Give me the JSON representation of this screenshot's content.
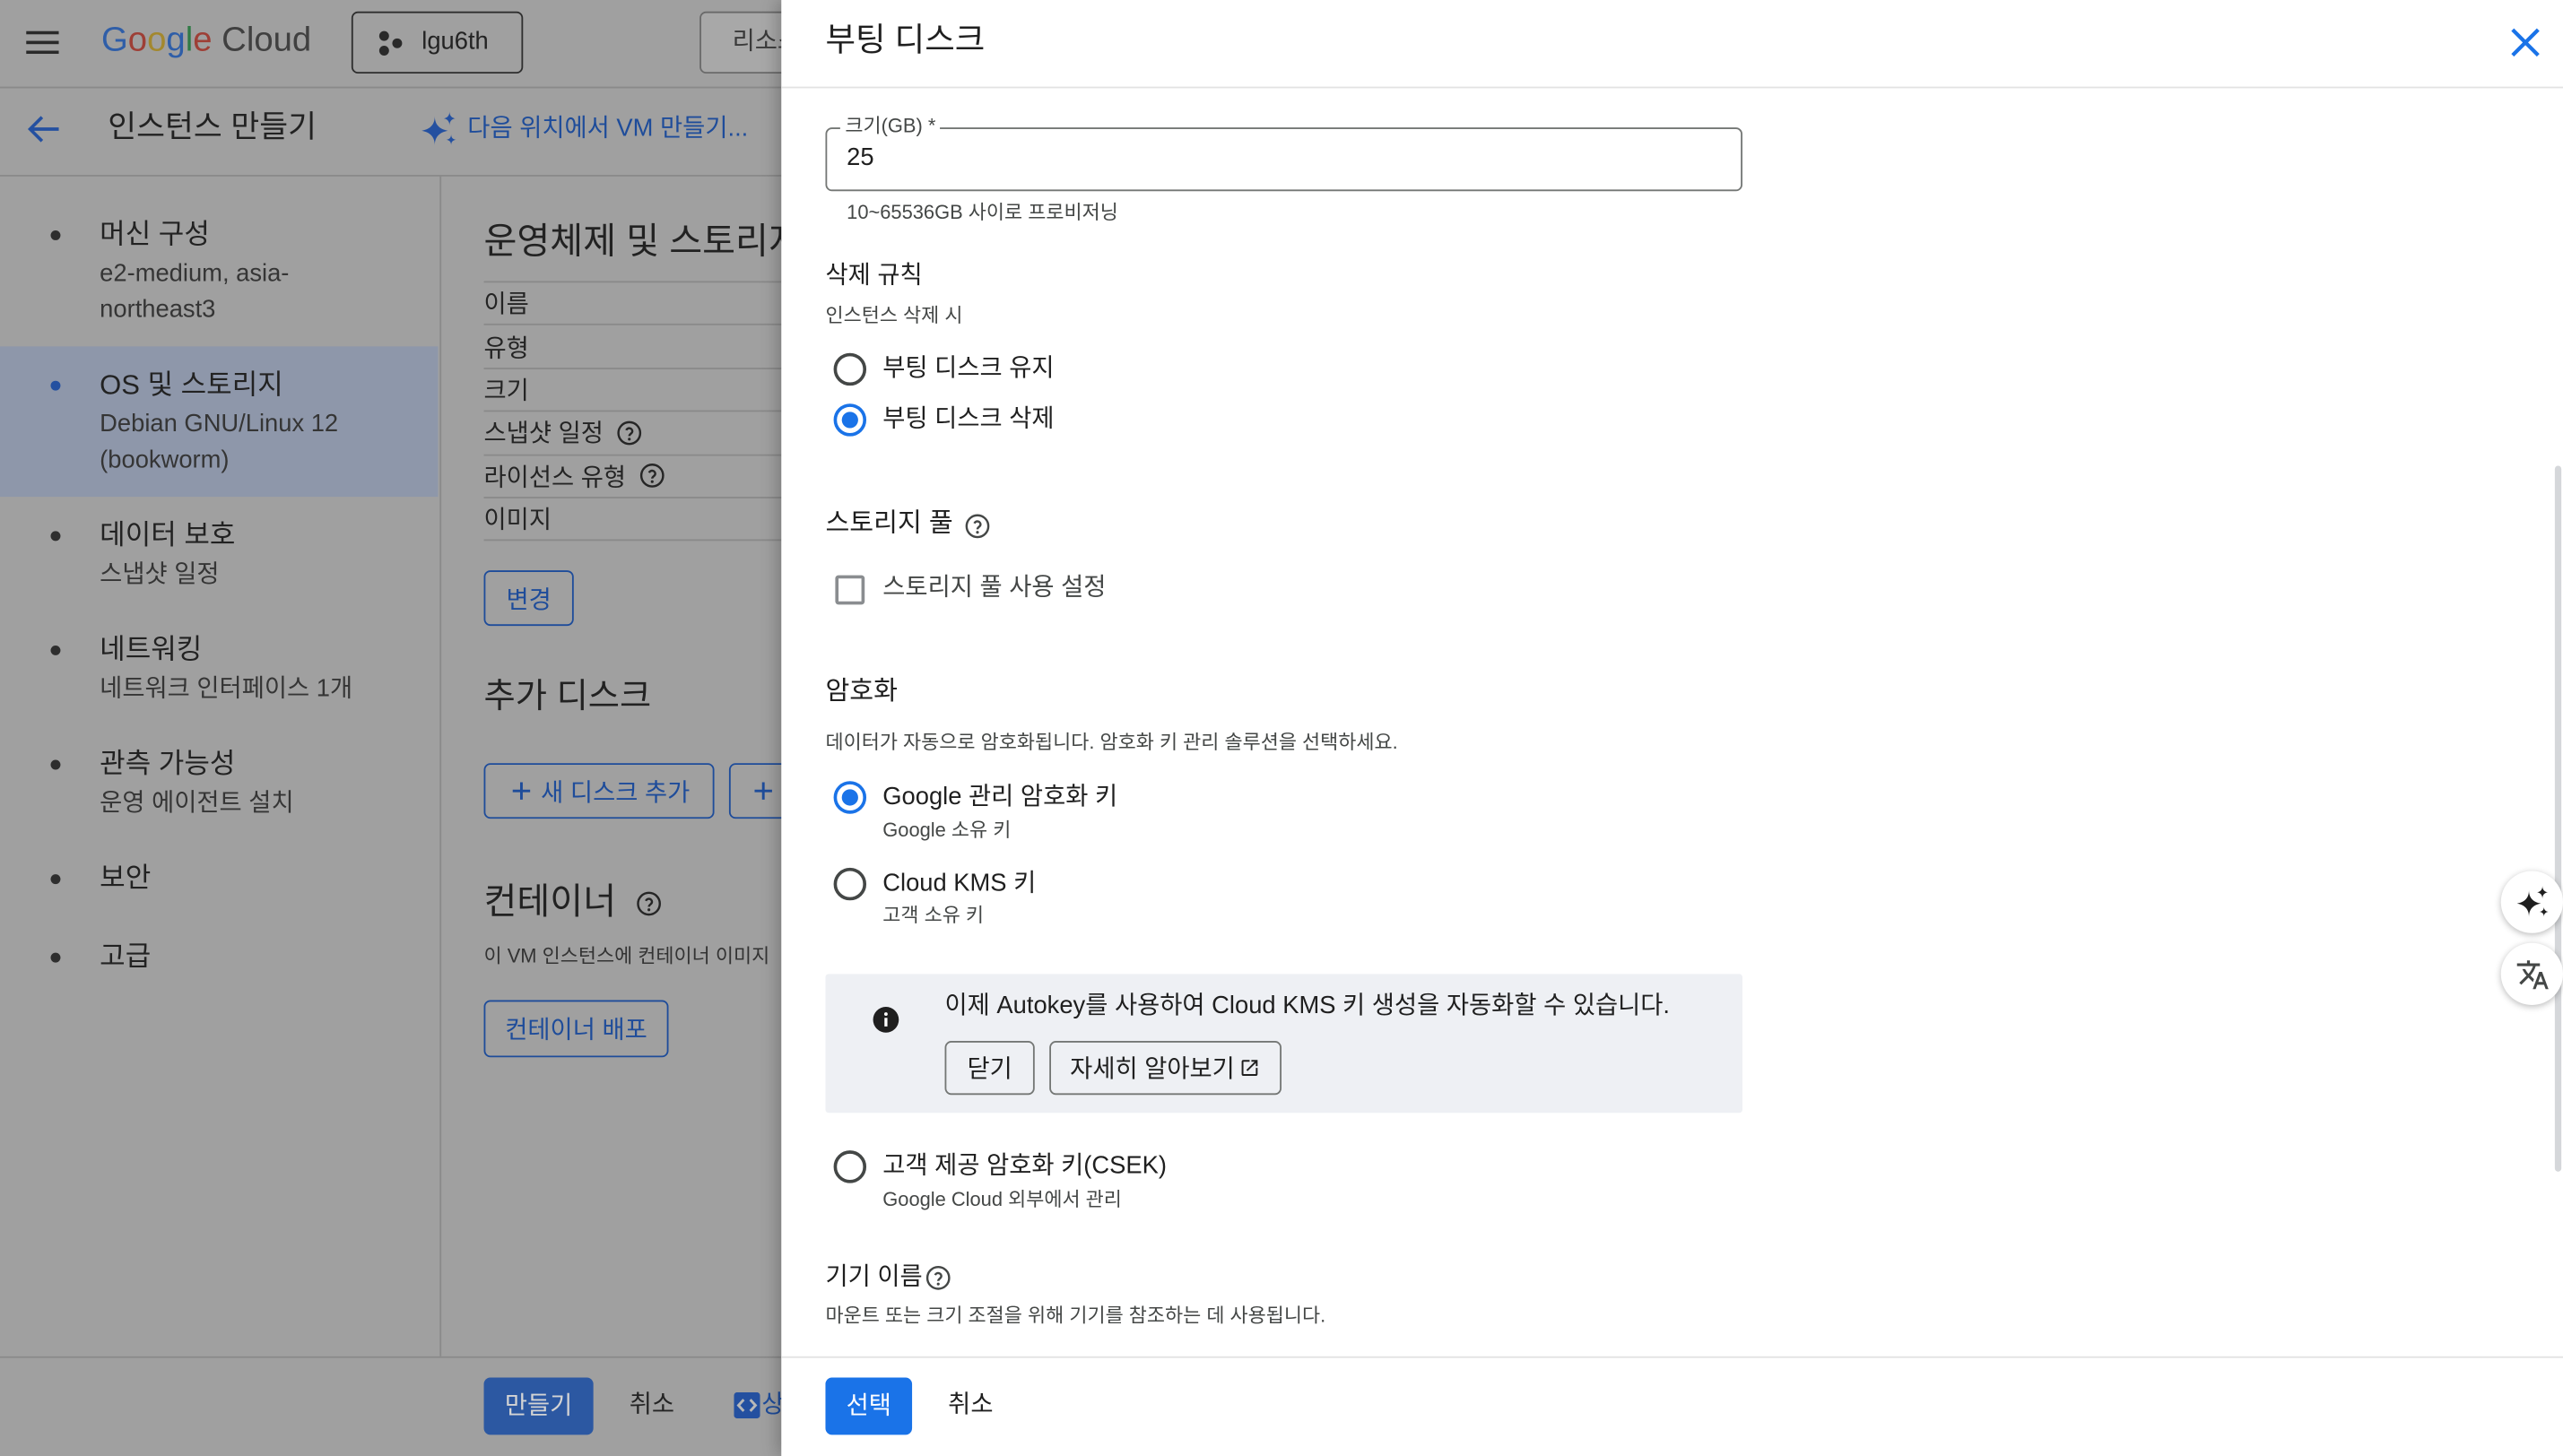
{
  "header": {
    "logo_google": "Google",
    "logo_cloud": "Cloud",
    "project": "lgu6th",
    "search_placeholder": "리소스"
  },
  "page": {
    "title": "인스턴스 만들기",
    "ai_action": "다음 위치에서 VM 만들기..."
  },
  "nav": [
    {
      "title": "머신 구성",
      "subtitle": "e2-medium, asia-northeast3",
      "selected": false
    },
    {
      "title": "OS 및 스토리지",
      "subtitle": "Debian GNU/Linux 12 (bookworm)",
      "selected": true
    },
    {
      "title": "데이터 보호",
      "subtitle": "스냅샷 일정",
      "selected": false
    },
    {
      "title": "네트워킹",
      "subtitle": "네트워크 인터페이스 1개",
      "selected": false
    },
    {
      "title": "관측 가능성",
      "subtitle": "운영 에이전트 설치",
      "selected": false
    },
    {
      "title": "보안",
      "subtitle": "",
      "selected": false
    },
    {
      "title": "고급",
      "subtitle": "",
      "selected": false
    }
  ],
  "main": {
    "os_storage": {
      "heading": "운영체제 및 스토리지",
      "rows": [
        "이름",
        "유형",
        "크기",
        "스냅샷 일정",
        "라이선스 유형",
        "이미지"
      ],
      "change_button": "변경"
    },
    "additional_disks": {
      "heading": "추가 디스크",
      "add_new_button": "새 디스크 추가"
    },
    "container": {
      "heading": "컨테이너",
      "description": "이 VM 인스턴스에 컨테이너 이미지",
      "deploy_button": "컨테이너 배포"
    }
  },
  "footer": {
    "create_button": "만들기",
    "cancel_button": "취소",
    "code_link": "상"
  },
  "panel": {
    "title": "부팅 디스크",
    "size": {
      "label": "크기(GB) *",
      "value": "25",
      "helper": "10~65536GB 사이로 프로비저닝"
    },
    "deletion_rule": {
      "heading": "삭제 규칙",
      "subheading": "인스턴스 삭제 시",
      "options": [
        {
          "label": "부팅 디스크 유지",
          "selected": false
        },
        {
          "label": "부팅 디스크 삭제",
          "selected": true
        }
      ]
    },
    "storage_pool": {
      "heading": "스토리지 풀",
      "checkbox_label": "스토리지 풀 사용 설정",
      "checked": false
    },
    "encryption": {
      "heading": "암호화",
      "description": "데이터가 자동으로 암호화됩니다. 암호화 키 관리 솔루션을 선택하세요.",
      "options": [
        {
          "label": "Google 관리 암호화 키",
          "sub": "Google 소유 키",
          "selected": true
        },
        {
          "label": "Cloud KMS 키",
          "sub": "고객 소유 키",
          "selected": false
        },
        {
          "label": "고객 제공 암호화 키(CSEK)",
          "sub": "Google Cloud 외부에서 관리",
          "selected": false
        }
      ],
      "info": {
        "text": "이제 Autokey를 사용하여 Cloud KMS 키 생성을 자동화할 수 있습니다.",
        "dismiss_button": "닫기",
        "learn_more_button": "자세히 알아보기"
      }
    },
    "device_name": {
      "heading": "기기 이름",
      "description": "마운트 또는 크기 조절을 위해 기기를 참조하는 데 사용됩니다."
    },
    "actions": {
      "select_button": "선택",
      "cancel_button": "취소"
    }
  },
  "colors": {
    "accent": "#1a73e8",
    "scrim": "#a0a0a0",
    "selected_nav": "#8e97aa",
    "info_box": "#eef0f4",
    "dim_blue": "#1e4c9a",
    "logo_letters": [
      "#2f5ea8",
      "#9e3f36",
      "#a3882e",
      "#2f5ea8",
      "#2f7a45",
      "#9e3f36"
    ]
  }
}
